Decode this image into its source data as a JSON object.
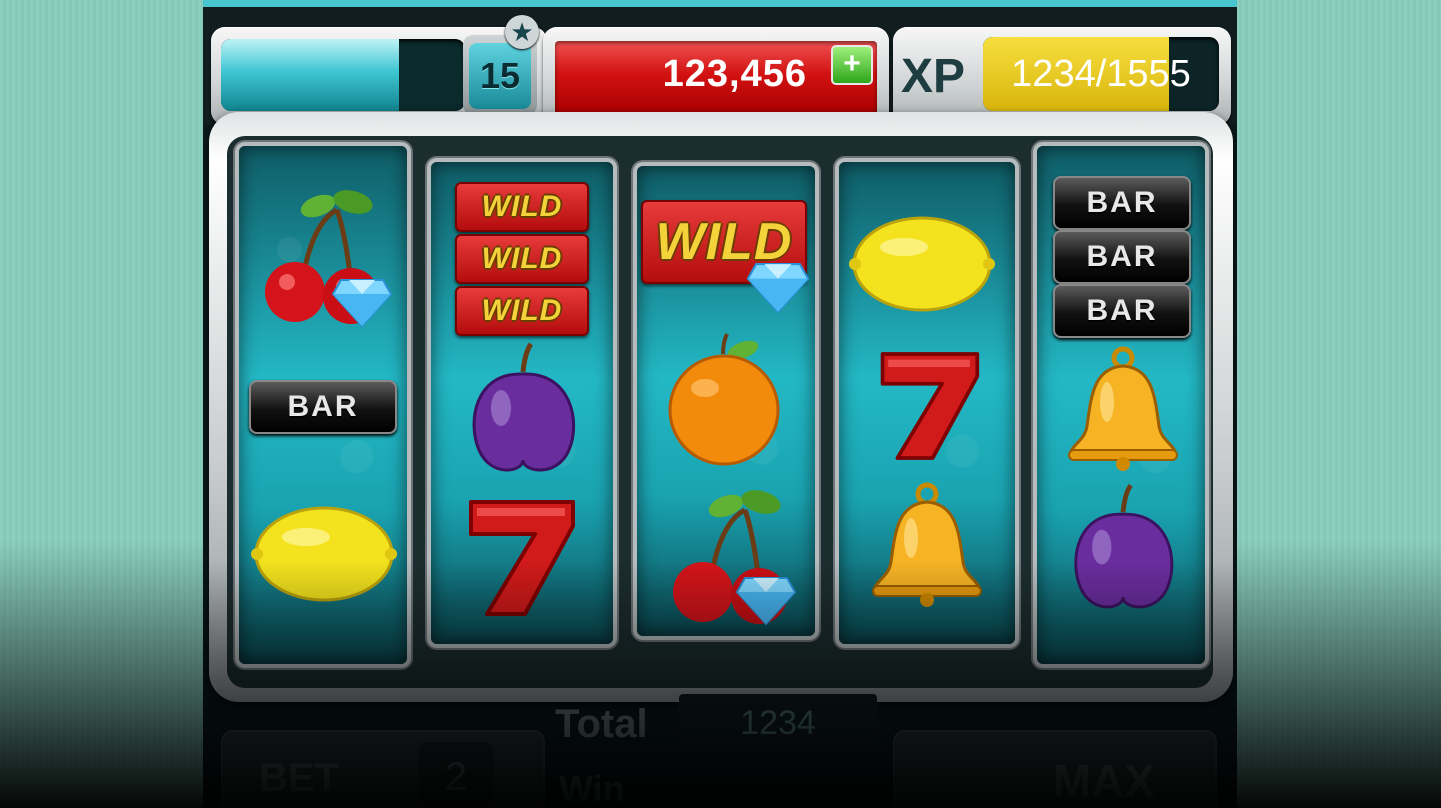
{
  "hud": {
    "energy_fraction": 0.73,
    "level": "15",
    "coins": "123,456",
    "add_coins_symbol": "+",
    "xp_label": "XP",
    "xp_text": "1234/1555",
    "xp_fraction": 0.79
  },
  "reels": [
    [
      "cherry-diamond",
      "bar",
      "lemon"
    ],
    [
      "wild-x3",
      "plum",
      "seven"
    ],
    [
      "wild-diamond",
      "orange",
      "cherry-diamond"
    ],
    [
      "lemon",
      "seven",
      "bell"
    ],
    [
      "bar-x3",
      "bell",
      "plum"
    ]
  ],
  "symbols": {
    "bar_label": "BAR",
    "wild_label": "WILD",
    "seven_label": "7"
  },
  "controls": {
    "total_label": "Total",
    "total_value": "1234",
    "bet_label": "BET",
    "bet_value": "2",
    "win_label": "Win",
    "max_label": "MAX"
  },
  "colors": {
    "background": "#8ccfc0",
    "reel_teal": "#23b8c5",
    "coin_red": "#d21111",
    "xp_yellow": "#f2d21f"
  }
}
